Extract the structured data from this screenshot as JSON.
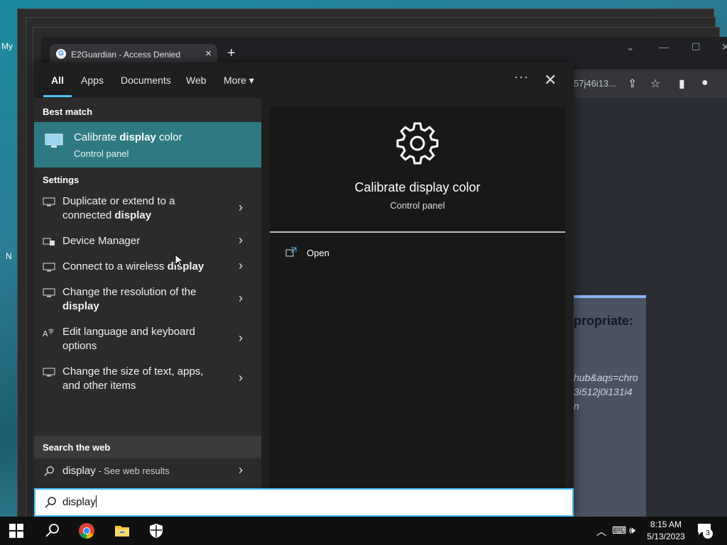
{
  "desktop": {
    "label_my": "My",
    "label_n": "N"
  },
  "browser": {
    "tab_title": "E2Guardian - Access Denied",
    "new_tab": "+",
    "url_tail": "57j46i13...",
    "page_heading": "propriate:",
    "page_lines": [
      "hub&aqs=chro",
      "3i512j0i131i4",
      "n"
    ]
  },
  "search": {
    "tabs": [
      {
        "label": "All"
      },
      {
        "label": "Apps"
      },
      {
        "label": "Documents"
      },
      {
        "label": "Web"
      },
      {
        "label": "More"
      }
    ],
    "more_caret": "▾",
    "dots": "···",
    "close": "✕",
    "sections": {
      "best_match": "Best match",
      "settings": "Settings",
      "web": "Search the web"
    },
    "best_match": {
      "title_pre": "Calibrate ",
      "title_bold": "display",
      "title_post": " color",
      "subtitle": "Control panel"
    },
    "settings_items": [
      {
        "pre": "Duplicate or extend to a connected ",
        "bold": "display",
        "post": ""
      },
      {
        "pre": "Device Manager",
        "bold": "",
        "post": ""
      },
      {
        "pre": "Connect to a wireless ",
        "bold": "display",
        "post": ""
      },
      {
        "pre": "Change the resolution of the ",
        "bold": "display",
        "post": ""
      },
      {
        "pre": "Edit language and keyboard options",
        "bold": "",
        "post": ""
      },
      {
        "pre": "Change the size of text, apps, and other items",
        "bold": "",
        "post": ""
      }
    ],
    "web_result": {
      "query": "display",
      "suffix": " - See web results"
    },
    "chevron": "›",
    "detail": {
      "title": "Calibrate display color",
      "subtitle": "Control panel",
      "open": "Open"
    },
    "query": "display"
  },
  "taskbar": {
    "time": "8:15 AM",
    "date": "5/13/2023",
    "notif_count": "3"
  }
}
